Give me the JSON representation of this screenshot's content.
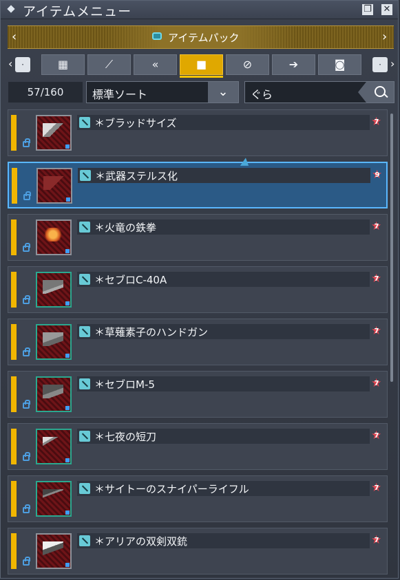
{
  "window": {
    "title": "アイテムメニュー"
  },
  "pack": {
    "label": "アイテムパック"
  },
  "tabs": [
    {
      "icon": "grid-icon",
      "glyph": "▦"
    },
    {
      "icon": "sword-icon",
      "glyph": "⟋"
    },
    {
      "icon": "double-arrow-icon",
      "glyph": "«"
    },
    {
      "icon": "shirt-icon",
      "glyph": "👕"
    },
    {
      "icon": "tag-icon",
      "glyph": "⌂"
    },
    {
      "icon": "arrow-sign-icon",
      "glyph": "➤"
    },
    {
      "icon": "bag-icon",
      "glyph": "◙"
    }
  ],
  "filter": {
    "count": "57/160",
    "sort_label": "標準ソート",
    "search_text": "ぐら"
  },
  "items": [
    {
      "name": "＊ブラッドサイズ",
      "badge": "7",
      "frame": "gray"
    },
    {
      "name": "＊武器ステルス化",
      "badge": "9",
      "frame": "gray"
    },
    {
      "name": "＊火竜の鉄拳",
      "badge": "7",
      "frame": "gray"
    },
    {
      "name": "＊セブロC-40A",
      "badge": "7",
      "frame": "green"
    },
    {
      "name": "＊草薙素子のハンドガン",
      "badge": "7",
      "frame": "green"
    },
    {
      "name": "＊セブロM-5",
      "badge": "7",
      "frame": "green"
    },
    {
      "name": "＊七夜の短刀",
      "badge": "7",
      "frame": "green"
    },
    {
      "name": "＊サイトーのスナイパーライフル",
      "badge": "7",
      "frame": "green"
    },
    {
      "name": "＊アリアの双剣双銃",
      "badge": "7",
      "frame": "gray"
    }
  ],
  "colors": {
    "accent": "#e0a800",
    "selected": "#2b5a86",
    "rarity": "#f1b600"
  }
}
